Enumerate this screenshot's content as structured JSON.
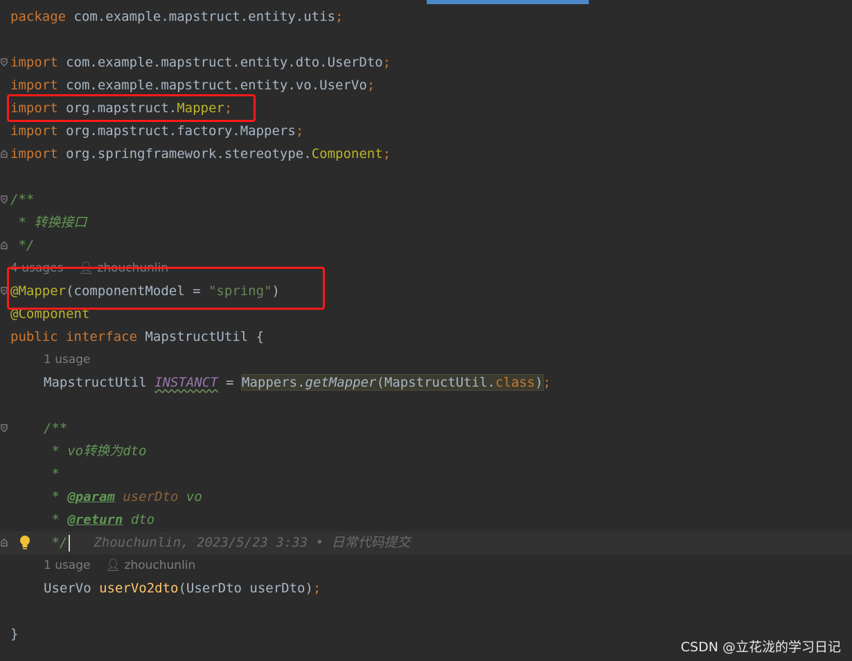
{
  "editor": {
    "lines": {
      "package": {
        "kw": "package",
        "rest": " com.example.mapstruct.entity.utis",
        "semi": ";"
      },
      "import1": {
        "kw": "import",
        "rest": " com.example.mapstruct.entity.dto.UserDto",
        "semi": ";"
      },
      "import2": {
        "kw": "import",
        "rest": " com.example.mapstruct.entity.vo.UserVo",
        "semi": ";"
      },
      "import3": {
        "kw": "import",
        "pkg": " org.mapstruct.",
        "cls": "Mapper",
        "semi": ";"
      },
      "import4": {
        "kw": "import",
        "rest": " org.mapstruct.factory.Mappers",
        "semi": ";"
      },
      "import5": {
        "kw": "import",
        "pkg": " org.springframework.stereotype.",
        "cls": "Component",
        "semi": ";"
      },
      "doc1_open": "/**",
      "doc1_text": " * 转换接口",
      "doc1_close": " */",
      "hint_interface": {
        "usages": "4 usages",
        "author": "zhouchunlin"
      },
      "mapper_annotation": {
        "ann": "@Mapper",
        "open": "(componentModel = ",
        "str": "\"spring\"",
        "close": ")"
      },
      "component_annotation": "@Component",
      "interface_decl": {
        "kw1": "public",
        "kw2": "interface",
        "name": " MapstructUtil {"
      },
      "hint_instance": {
        "usages": "1 usage"
      },
      "instance_decl": {
        "type": "MapstructUtil ",
        "field": "INSTANCT",
        "eq": " = ",
        "call_cls": "Mappers.",
        "call_fn": "getMapper",
        "args_open": "(MapstructUtil.",
        "args_kw": "class",
        "args_close": ")",
        "semi": ";"
      },
      "doc2_open": "/**",
      "doc2_text": " * vo转换为dto",
      "doc2_star": " *",
      "doc2_param": {
        "prefix": " * ",
        "tag": "@param",
        "name": " userDto",
        "desc": " vo"
      },
      "doc2_return": {
        "prefix": " * ",
        "tag": "@return",
        "desc": " dto"
      },
      "doc2_close": " */",
      "blame": "Zhouchunlin, 2023/5/23 3:33 • 日常代码提交",
      "hint_method": {
        "usages": "1 usage",
        "author": "zhouchunlin"
      },
      "method_decl": {
        "ret": "UserVo ",
        "name": "userVo2dto",
        "params": "(UserDto userDto)",
        "semi": ";"
      },
      "close_brace": "}"
    }
  },
  "icons": {
    "fold": "fold-marker-icon",
    "bulb": "lightbulb-icon",
    "person": "person-icon"
  },
  "colors": {
    "highlight_box": "#ff1a1a",
    "background": "#2b2b2b"
  },
  "watermark": "CSDN @立花泷的学习日记"
}
